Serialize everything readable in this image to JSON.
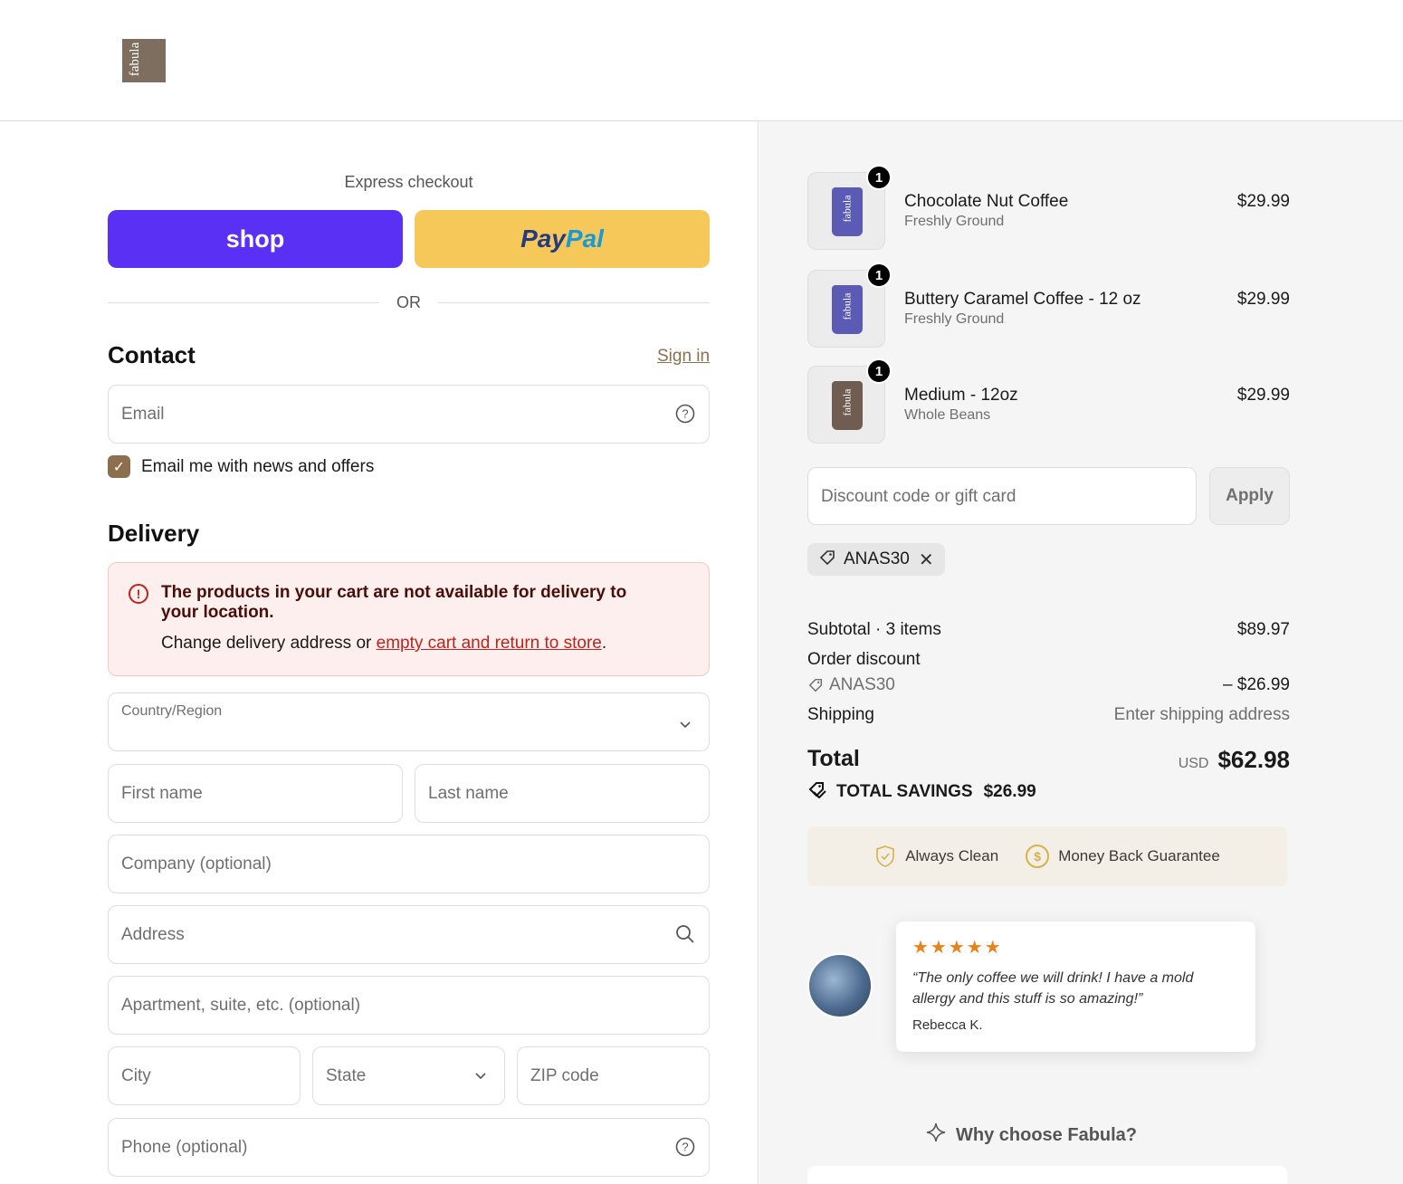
{
  "header": {
    "logo_text": "fabula"
  },
  "left": {
    "express_label": "Express checkout",
    "shop_label": "shop",
    "paypal_part1": "Pay",
    "paypal_part2": "Pal",
    "or_label": "OR",
    "contact_heading": "Contact",
    "sign_in": "Sign in",
    "email_placeholder": "Email",
    "newsletter_label": "Email me with news and offers",
    "delivery_heading": "Delivery",
    "alert_title": "The products in your cart are not available for delivery to your location.",
    "alert_body_prefix": "Change delivery address or ",
    "alert_link": "empty cart and return to store",
    "alert_body_suffix": ".",
    "country_label": "Country/Region",
    "first_name": "First name",
    "last_name": "Last name",
    "company": "Company (optional)",
    "address": "Address",
    "apartment": "Apartment, suite, etc. (optional)",
    "city": "City",
    "state": "State",
    "zip": "ZIP code",
    "phone": "Phone (optional)"
  },
  "cart": {
    "items": [
      {
        "name": "Chocolate Nut Coffee",
        "variant": "Freshly Ground",
        "price": "$29.99",
        "qty": "1",
        "bag_color": "#5b5bb6"
      },
      {
        "name": "Buttery Caramel Coffee - 12 oz",
        "variant": "Freshly Ground",
        "price": "$29.99",
        "qty": "1",
        "bag_color": "#5b5bb6"
      },
      {
        "name": "Medium - 12oz",
        "variant": "Whole Beans",
        "price": "$29.99",
        "qty": "1",
        "bag_color": "#6e5d50"
      }
    ],
    "discount_placeholder": "Discount code or gift card",
    "apply_label": "Apply",
    "applied_code": "ANAS30",
    "subtotal_label": "Subtotal · 3 items",
    "subtotal_value": "$89.97",
    "order_discount_label": "Order discount",
    "order_discount_code": "ANAS30",
    "order_discount_value": "– $26.99",
    "shipping_label": "Shipping",
    "shipping_value": "Enter shipping address",
    "total_label": "Total",
    "currency": "USD",
    "total_value": "$62.98",
    "savings_label": "TOTAL SAVINGS",
    "savings_value": "$26.99"
  },
  "badges": {
    "clean": "Always Clean",
    "guarantee": "Money Back Guarantee"
  },
  "review": {
    "stars": "★★★★★",
    "quote": "“The only coffee we will drink! I have a mold allergy and this stuff is so amazing!”",
    "author": "Rebecca K."
  },
  "why_heading": "Why choose Fabula?",
  "colors": {
    "shop": "#5a31f4",
    "paypal": "#f6c759",
    "accent": "#8b6f4e",
    "error": "#c0231e"
  }
}
